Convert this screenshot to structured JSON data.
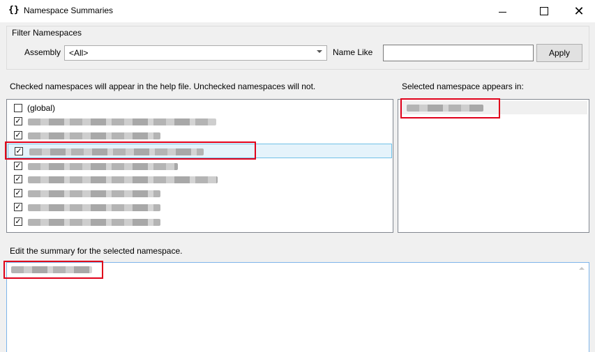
{
  "window": {
    "title": "Namespace Summaries",
    "icon": "braces-icon",
    "icon_glyph": "{}"
  },
  "filter": {
    "group_label": "Filter Namespaces",
    "assembly_label": "Assembly",
    "assembly_value": "<All>",
    "name_like_label": "Name Like",
    "name_like_value": "",
    "apply_label": "Apply"
  },
  "namespaces": {
    "heading": "Checked namespaces will appear in the help file.  Unchecked namespaces will not.",
    "items": [
      {
        "label": "(global)",
        "checked": false,
        "blurred": false,
        "selected": false
      },
      {
        "label": "",
        "checked": true,
        "blurred": true,
        "selected": false
      },
      {
        "label": "",
        "checked": true,
        "blurred": true,
        "selected": false
      },
      {
        "label": "",
        "checked": true,
        "blurred": true,
        "selected": true
      },
      {
        "label": "",
        "checked": true,
        "blurred": true,
        "selected": false
      },
      {
        "label": "",
        "checked": true,
        "blurred": true,
        "selected": false
      },
      {
        "label": "",
        "checked": true,
        "blurred": true,
        "selected": false
      },
      {
        "label": "",
        "checked": true,
        "blurred": true,
        "selected": false
      },
      {
        "label": "",
        "checked": true,
        "blurred": true,
        "selected": false
      }
    ]
  },
  "appears_in": {
    "heading": "Selected namespace appears in:"
  },
  "summary": {
    "heading": "Edit the summary for the selected namespace."
  },
  "colors": {
    "highlight_red": "#e0001a",
    "selection_blue": "#e5f3fb"
  }
}
